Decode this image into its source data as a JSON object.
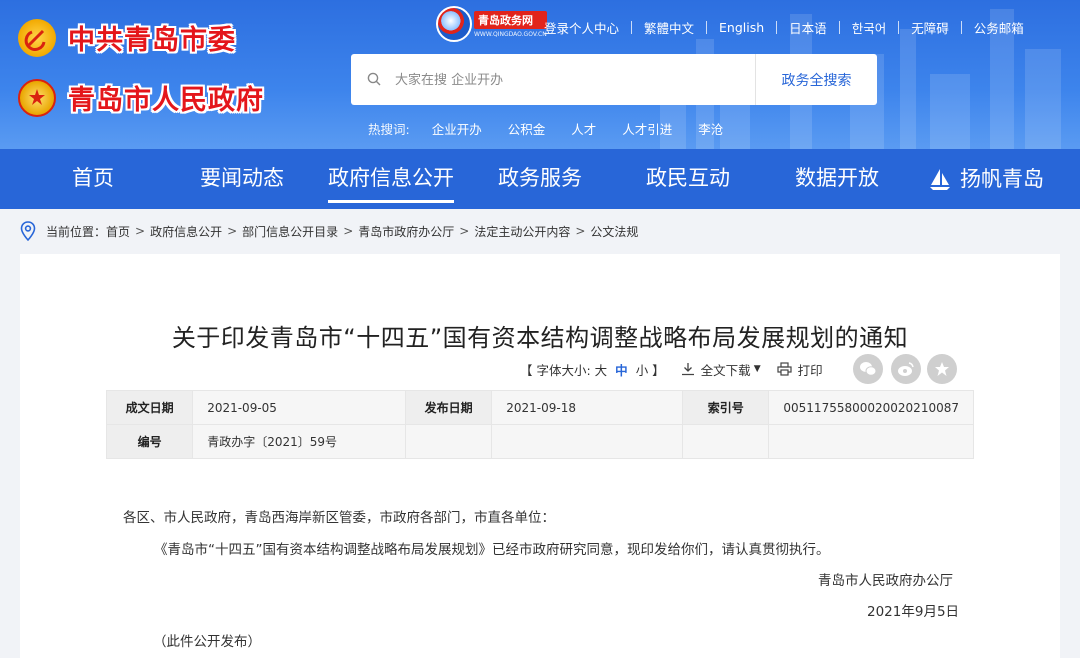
{
  "header": {
    "logo_party": "中共青岛市委",
    "logo_gov": "青岛市人民政府",
    "portal": {
      "name": "青岛政务网",
      "url": "WWW.QINGDAO.GOV.CN"
    },
    "toplinks": [
      "登录个人中心",
      "繁體中文",
      "English",
      "日本语",
      "한국어",
      "无障碍",
      "公务邮箱"
    ],
    "search": {
      "placeholder": "大家在搜 企业开办",
      "button": "政务全搜索"
    },
    "hotwords": {
      "label": "热搜词:",
      "items": [
        "企业开办",
        "公积金",
        "人才",
        "人才引进",
        "李沧"
      ]
    }
  },
  "nav": {
    "items": [
      "首页",
      "要闻动态",
      "政府信息公开",
      "政务服务",
      "政民互动",
      "数据开放",
      "扬帆青岛"
    ],
    "active_index": 2
  },
  "breadcrumb": {
    "label": "当前位置：",
    "items": [
      "首页",
      "政府信息公开",
      "部门信息公开目录",
      "青岛市政府办公厅",
      "法定主动公开内容",
      "公文法规"
    ]
  },
  "article": {
    "title": "关于印发青岛市“十四五”国有资本结构调整战略布局发展规划的通知",
    "tools": {
      "fontsize_label": "【 字体大小: 大",
      "fontsize_mid": "中",
      "fontsize_small": "小 】",
      "download": "全文下载",
      "print": "打印"
    },
    "meta": {
      "cwrq_k": "成文日期",
      "cwrq_v": "2021-09-05",
      "fbrq_k": "发布日期",
      "fbrq_v": "2021-09-18",
      "syh_k": "索引号",
      "syh_v": "00511755800020020210087",
      "bh_k": "编号",
      "bh_v": "青政办字〔2021〕59号"
    },
    "body": {
      "recipients": "各区、市人民政府，青岛西海岸新区管委，市政府各部门，市直各单位：",
      "main": "《青岛市“十四五”国有资本结构调整战略布局发展规划》已经市政府研究同意，现印发给你们，请认真贯彻执行。",
      "signer": "青岛市人民政府办公厅",
      "date": "2021年9月5日",
      "note": "（此件公开发布）"
    }
  },
  "colors": {
    "primary": "#2866d8",
    "header_bg": "#3d84ec",
    "logo_red": "#e4161b",
    "page_bg": "#f1f3f7"
  }
}
